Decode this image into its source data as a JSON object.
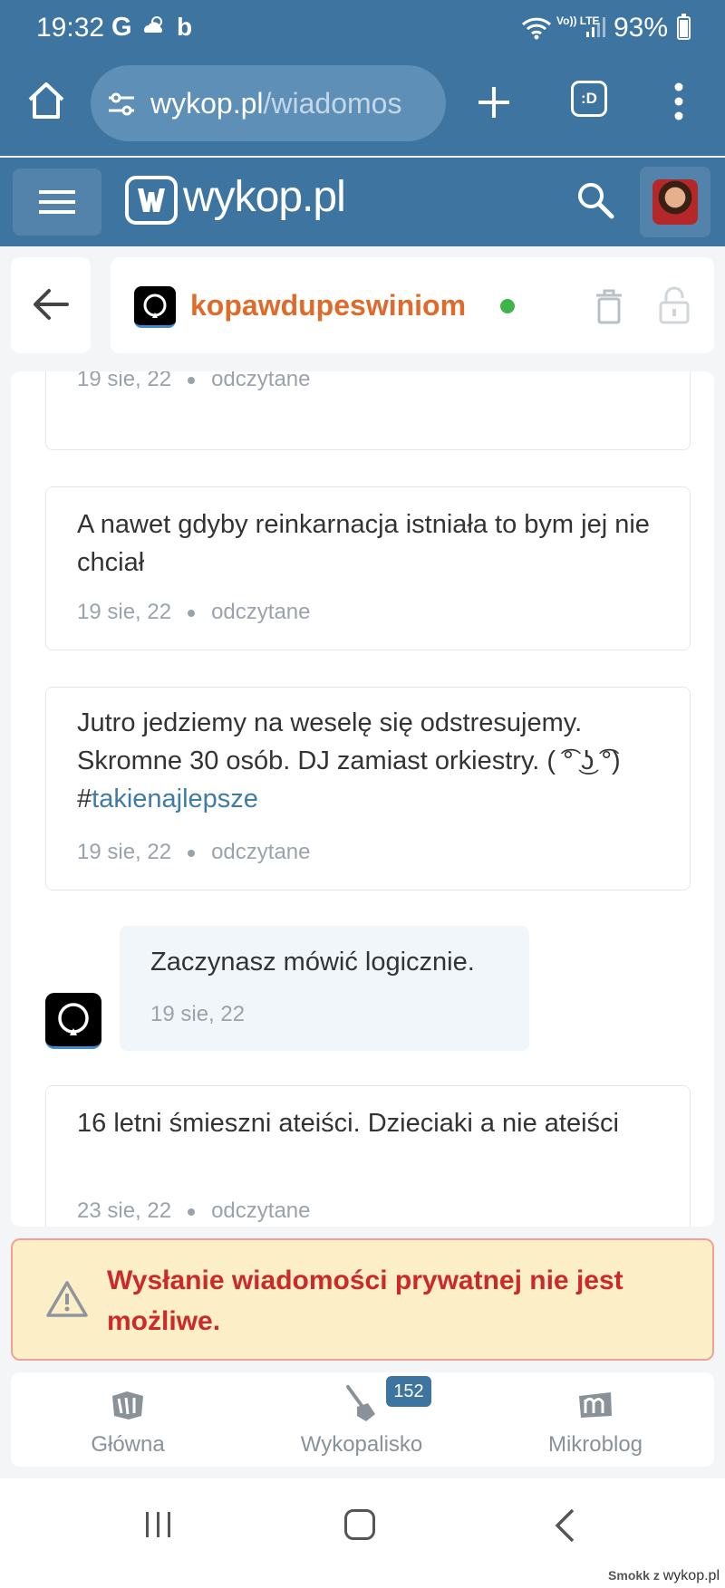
{
  "status_bar": {
    "time": "19:32",
    "g_label": "G",
    "b_label": "b",
    "lte_label": "Vo)) LTE",
    "battery": "93%"
  },
  "browser": {
    "url_domain": "wykop.pl",
    "url_path": "/wiadomos",
    "tabs_label": ":D"
  },
  "site_header": {
    "logo_text": "wykop.pl"
  },
  "conversation": {
    "username": "kopawdupeswiniom",
    "online": true
  },
  "messages": [
    {
      "text": "",
      "date": "19 sie, 22",
      "status": "odczytane"
    },
    {
      "text": "A nawet gdyby reinkarnacja istniała to bym jej nie chciał",
      "date": "19 sie, 22",
      "status": "odczytane"
    },
    {
      "text": "Jutro jedziemy na weselę się odstresujemy. Skromne 30 osób. DJ zamiast orkiestry. ( ͡° ͜ʖ ͡°)",
      "hashtag_prefix": "#",
      "hashtag": "takienajlepsze",
      "date": "19 sie, 22",
      "status": "odczytane"
    },
    {
      "text": "16 letni śmieszni ateiści. Dzieciaki a nie ateiści",
      "date": "23 sie, 22",
      "status": "odczytane"
    }
  ],
  "own_message": {
    "text": "Zaczynasz mówić logicznie.",
    "date": "19 sie, 22"
  },
  "alert": {
    "text": "Wysłanie wiadomości prywatnej nie jest możliwe."
  },
  "bottom_nav": {
    "items": [
      {
        "label": "Główna",
        "icon": "home-w-icon"
      },
      {
        "label": "Wykopalisko",
        "icon": "shovel-icon",
        "badge": "152"
      },
      {
        "label": "Mikroblog",
        "icon": "mikroblog-m-icon"
      }
    ]
  },
  "watermark": {
    "prefix": "Smokk z",
    "brand": "wykop.pl"
  },
  "colors": {
    "brand_blue": "#3e75a0",
    "username_orange": "#e06a2a",
    "alert_red": "#cc2a2a",
    "alert_bg": "#fcefc7",
    "online_green": "#3fb44c"
  }
}
